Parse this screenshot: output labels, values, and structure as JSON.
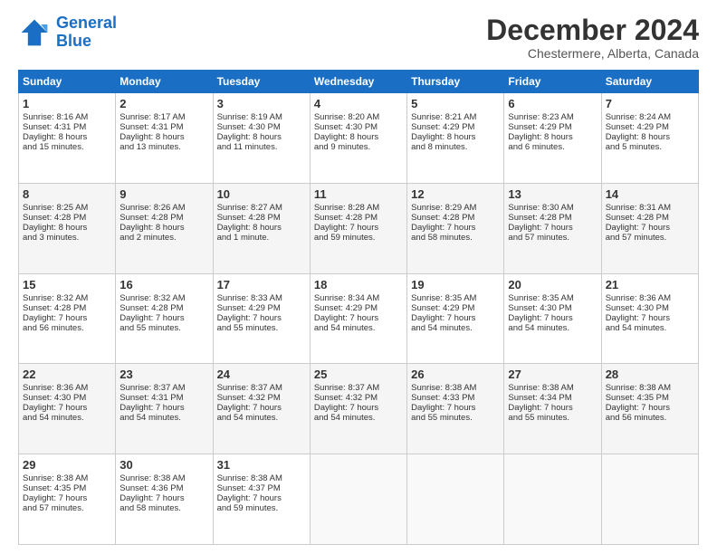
{
  "logo": {
    "line1": "General",
    "line2": "Blue"
  },
  "title": "December 2024",
  "subtitle": "Chestermere, Alberta, Canada",
  "days_of_week": [
    "Sunday",
    "Monday",
    "Tuesday",
    "Wednesday",
    "Thursday",
    "Friday",
    "Saturday"
  ],
  "weeks": [
    [
      {
        "day": "1",
        "info": "Sunrise: 8:16 AM\nSunset: 4:31 PM\nDaylight: 8 hours\nand 15 minutes."
      },
      {
        "day": "2",
        "info": "Sunrise: 8:17 AM\nSunset: 4:31 PM\nDaylight: 8 hours\nand 13 minutes."
      },
      {
        "day": "3",
        "info": "Sunrise: 8:19 AM\nSunset: 4:30 PM\nDaylight: 8 hours\nand 11 minutes."
      },
      {
        "day": "4",
        "info": "Sunrise: 8:20 AM\nSunset: 4:30 PM\nDaylight: 8 hours\nand 9 minutes."
      },
      {
        "day": "5",
        "info": "Sunrise: 8:21 AM\nSunset: 4:29 PM\nDaylight: 8 hours\nand 8 minutes."
      },
      {
        "day": "6",
        "info": "Sunrise: 8:23 AM\nSunset: 4:29 PM\nDaylight: 8 hours\nand 6 minutes."
      },
      {
        "day": "7",
        "info": "Sunrise: 8:24 AM\nSunset: 4:29 PM\nDaylight: 8 hours\nand 5 minutes."
      }
    ],
    [
      {
        "day": "8",
        "info": "Sunrise: 8:25 AM\nSunset: 4:28 PM\nDaylight: 8 hours\nand 3 minutes."
      },
      {
        "day": "9",
        "info": "Sunrise: 8:26 AM\nSunset: 4:28 PM\nDaylight: 8 hours\nand 2 minutes."
      },
      {
        "day": "10",
        "info": "Sunrise: 8:27 AM\nSunset: 4:28 PM\nDaylight: 8 hours\nand 1 minute."
      },
      {
        "day": "11",
        "info": "Sunrise: 8:28 AM\nSunset: 4:28 PM\nDaylight: 7 hours\nand 59 minutes."
      },
      {
        "day": "12",
        "info": "Sunrise: 8:29 AM\nSunset: 4:28 PM\nDaylight: 7 hours\nand 58 minutes."
      },
      {
        "day": "13",
        "info": "Sunrise: 8:30 AM\nSunset: 4:28 PM\nDaylight: 7 hours\nand 57 minutes."
      },
      {
        "day": "14",
        "info": "Sunrise: 8:31 AM\nSunset: 4:28 PM\nDaylight: 7 hours\nand 57 minutes."
      }
    ],
    [
      {
        "day": "15",
        "info": "Sunrise: 8:32 AM\nSunset: 4:28 PM\nDaylight: 7 hours\nand 56 minutes."
      },
      {
        "day": "16",
        "info": "Sunrise: 8:32 AM\nSunset: 4:28 PM\nDaylight: 7 hours\nand 55 minutes."
      },
      {
        "day": "17",
        "info": "Sunrise: 8:33 AM\nSunset: 4:29 PM\nDaylight: 7 hours\nand 55 minutes."
      },
      {
        "day": "18",
        "info": "Sunrise: 8:34 AM\nSunset: 4:29 PM\nDaylight: 7 hours\nand 54 minutes."
      },
      {
        "day": "19",
        "info": "Sunrise: 8:35 AM\nSunset: 4:29 PM\nDaylight: 7 hours\nand 54 minutes."
      },
      {
        "day": "20",
        "info": "Sunrise: 8:35 AM\nSunset: 4:30 PM\nDaylight: 7 hours\nand 54 minutes."
      },
      {
        "day": "21",
        "info": "Sunrise: 8:36 AM\nSunset: 4:30 PM\nDaylight: 7 hours\nand 54 minutes."
      }
    ],
    [
      {
        "day": "22",
        "info": "Sunrise: 8:36 AM\nSunset: 4:30 PM\nDaylight: 7 hours\nand 54 minutes."
      },
      {
        "day": "23",
        "info": "Sunrise: 8:37 AM\nSunset: 4:31 PM\nDaylight: 7 hours\nand 54 minutes."
      },
      {
        "day": "24",
        "info": "Sunrise: 8:37 AM\nSunset: 4:32 PM\nDaylight: 7 hours\nand 54 minutes."
      },
      {
        "day": "25",
        "info": "Sunrise: 8:37 AM\nSunset: 4:32 PM\nDaylight: 7 hours\nand 54 minutes."
      },
      {
        "day": "26",
        "info": "Sunrise: 8:38 AM\nSunset: 4:33 PM\nDaylight: 7 hours\nand 55 minutes."
      },
      {
        "day": "27",
        "info": "Sunrise: 8:38 AM\nSunset: 4:34 PM\nDaylight: 7 hours\nand 55 minutes."
      },
      {
        "day": "28",
        "info": "Sunrise: 8:38 AM\nSunset: 4:35 PM\nDaylight: 7 hours\nand 56 minutes."
      }
    ],
    [
      {
        "day": "29",
        "info": "Sunrise: 8:38 AM\nSunset: 4:35 PM\nDaylight: 7 hours\nand 57 minutes."
      },
      {
        "day": "30",
        "info": "Sunrise: 8:38 AM\nSunset: 4:36 PM\nDaylight: 7 hours\nand 58 minutes."
      },
      {
        "day": "31",
        "info": "Sunrise: 8:38 AM\nSunset: 4:37 PM\nDaylight: 7 hours\nand 59 minutes."
      },
      null,
      null,
      null,
      null
    ]
  ]
}
